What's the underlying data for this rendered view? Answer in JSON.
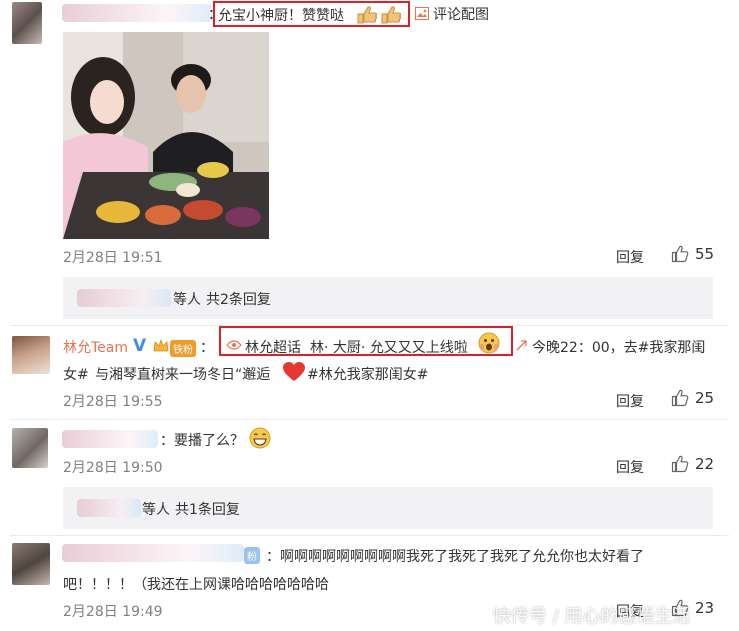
{
  "comment1": {
    "text": "允宝小神厨！赞赞哒",
    "pic_link": "评论配图",
    "time": "2月28日 19:51",
    "reply_label": "回复",
    "likes": "55",
    "reply_summary": {
      "suffix": "等人",
      "count": "共2条回复"
    }
  },
  "comment2": {
    "user": "林允Team",
    "badge": "铁粉",
    "topic": "林允超话",
    "text_boxed": "林· 大厨· 允又又又上线啦",
    "text_link": "今晚22：00，去#我家那闺",
    "line2_tag": "女#",
    "line2_text": "与湘琴直树来一场冬日“邂逅",
    "line2_tag2": "#林允我家那闺女#",
    "time": "2月28日 19:55",
    "reply_label": "回复",
    "likes": "25"
  },
  "comment3": {
    "text": "：要播了么？",
    "time": "2月28日 19:50",
    "reply_label": "回复",
    "likes": "22",
    "reply_summary": {
      "suffix": "等人",
      "count": "共1条回复"
    }
  },
  "comment4": {
    "badge": "粉",
    "line1": "：啊啊啊啊啊啊啊啊啊我死了我死了我死了允允你也太好看了",
    "line2": "吧！！！！（我还在上网课哈哈哈哈哈哈哈",
    "time": "2月28日 19:49",
    "reply_label": "回复",
    "likes": "23"
  },
  "watermark": "快传号 / 用心的感悟生活",
  "colors": {
    "accent": "#eb7350",
    "highlight_box": "#d9212b",
    "meta": "#808080",
    "reply_bg": "#f2f2f5"
  }
}
